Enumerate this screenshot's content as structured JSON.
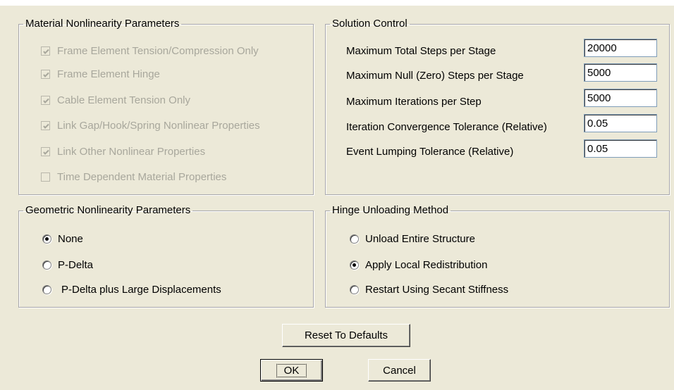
{
  "material": {
    "title": "Material Nonlinearity Parameters",
    "items": [
      {
        "label": "Frame Element Tension/Compression Only",
        "checked": true
      },
      {
        "label": "Frame Element Hinge",
        "checked": true
      },
      {
        "label": "Cable Element Tension Only",
        "checked": true
      },
      {
        "label": "Link Gap/Hook/Spring Nonlinear Properties",
        "checked": true
      },
      {
        "label": "Link Other Nonlinear Properties",
        "checked": true
      },
      {
        "label": "Time Dependent Material Properties",
        "checked": false
      }
    ]
  },
  "solution": {
    "title": "Solution Control",
    "fields": [
      {
        "label": "Maximum Total Steps per Stage",
        "value": "20000"
      },
      {
        "label": "Maximum Null (Zero) Steps per Stage",
        "value": "5000"
      },
      {
        "label": "Maximum Iterations per Step",
        "value": "5000"
      },
      {
        "label": "Iteration Convergence Tolerance (Relative)",
        "value": "0.05"
      },
      {
        "label": "Event Lumping Tolerance (Relative)",
        "value": "0.05"
      }
    ]
  },
  "geometric": {
    "title": "Geometric Nonlinearity Parameters",
    "options": [
      {
        "label": "None",
        "selected": true
      },
      {
        "label": "P-Delta",
        "selected": false
      },
      {
        "label": "P-Delta plus Large Displacements",
        "selected": false
      }
    ]
  },
  "hinge": {
    "title": "Hinge Unloading Method",
    "options": [
      {
        "label": "Unload Entire Structure",
        "selected": false
      },
      {
        "label": "Apply Local Redistribution",
        "selected": true
      },
      {
        "label": "Restart Using Secant Stiffness",
        "selected": false
      }
    ]
  },
  "buttons": {
    "reset": "Reset To Defaults",
    "ok": "OK",
    "cancel": "Cancel"
  }
}
